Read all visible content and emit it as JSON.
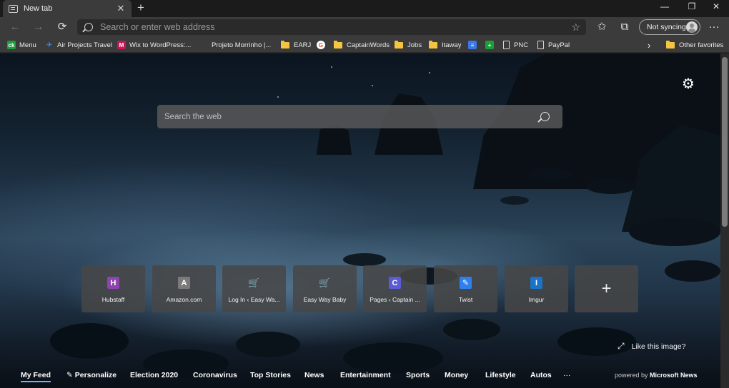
{
  "tab": {
    "title": "New tab",
    "close": "✕",
    "new": "+"
  },
  "window": {
    "minimize": "—",
    "restore": "❐",
    "close": "✕"
  },
  "toolbar": {
    "back": "←",
    "forward": "→",
    "refresh": "⟳",
    "address_placeholder": "Search or enter web address",
    "favorite_star": "☆",
    "favorites_icon": "✩",
    "collections_icon": "⧉",
    "sync_label": "Not syncing",
    "more": "···"
  },
  "favorites": [
    {
      "label": "Menu",
      "icon": "ck",
      "color": "#1e9e3a"
    },
    {
      "label": "Air Projects Travel",
      "icon": "✈",
      "color": "#2a6fd6"
    },
    {
      "label": "Wix to WordPress:...",
      "icon": "M",
      "color": "#c2185b"
    },
    {
      "label": "Projeto Morrinho |...",
      "icon": "",
      "color": ""
    },
    {
      "label": "EARJ",
      "icon": "folder",
      "color": "#f5c542"
    },
    {
      "label": "",
      "icon": "G",
      "color": "#ffffff"
    },
    {
      "label": "CaptainWords",
      "icon": "folder",
      "color": "#f5c542"
    },
    {
      "label": "Jobs",
      "icon": "folder",
      "color": "#f5c542"
    },
    {
      "label": "Itaway",
      "icon": "folder",
      "color": "#f5c542"
    },
    {
      "label": "",
      "icon": "≡",
      "color": "#3b78e7"
    },
    {
      "label": "",
      "icon": "+",
      "color": "#1e9e3a"
    },
    {
      "label": "PNC",
      "icon": "doc",
      "color": ""
    },
    {
      "label": "PayPal",
      "icon": "doc",
      "color": ""
    }
  ],
  "favorites_overflow": "›",
  "other_favorites": "Other favorites",
  "page": {
    "settings_icon": "⚙",
    "search_placeholder": "Search the web",
    "like_image": "Like this image?",
    "expand_icon": "⤢"
  },
  "top_sites": [
    {
      "label": "Hubstaff",
      "icon": "H",
      "color": "#8e44ad"
    },
    {
      "label": "Amazon.com",
      "icon": "A",
      "color": "#7a7a7a"
    },
    {
      "label": "Log In ‹ Easy Wa...",
      "icon": "🛒",
      "color": "#2bb5a0"
    },
    {
      "label": "Easy Way Baby",
      "icon": "🛒",
      "color": "#2bb5a0"
    },
    {
      "label": "Pages ‹ Captain ...",
      "icon": "C",
      "color": "#5b5bd6"
    },
    {
      "label": "Twist",
      "icon": "✎",
      "color": "#2f80ed"
    },
    {
      "label": "Imgur",
      "icon": "I",
      "color": "#1a73c7"
    }
  ],
  "add_site": "+",
  "news_nav": {
    "items": [
      "My Feed",
      "Personalize",
      "Election 2020",
      "Coronavirus",
      "Top Stories",
      "News",
      "Entertainment",
      "Sports",
      "Money",
      "Lifestyle",
      "Autos"
    ],
    "personalize_icon": "✎",
    "more": "···",
    "powered_prefix": "powered by",
    "powered_brand": "Microsoft News"
  }
}
